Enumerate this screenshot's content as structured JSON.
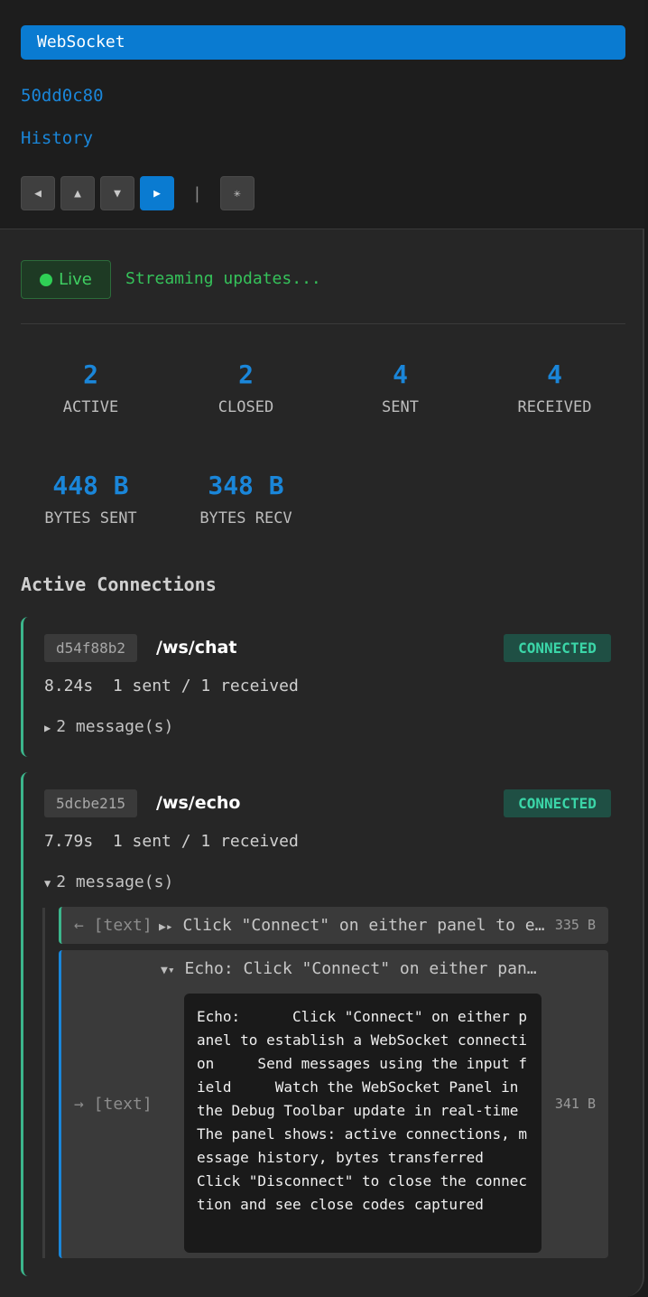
{
  "header": {
    "title": "WebSocket",
    "request_id": "50dd0c80",
    "history_link": "History",
    "nav_buttons": [
      "◀",
      "▲",
      "▼",
      "▶"
    ],
    "nav_separator": "|",
    "refresh_icon": "✳"
  },
  "live": {
    "badge_label": "Live",
    "status_text": "Streaming updates..."
  },
  "stats": [
    {
      "value": "2",
      "label": "ACTIVE"
    },
    {
      "value": "2",
      "label": "CLOSED"
    },
    {
      "value": "4",
      "label": "SENT"
    },
    {
      "value": "4",
      "label": "RECEIVED"
    },
    {
      "value": "448 B",
      "label": "BYTES SENT"
    },
    {
      "value": "348 B",
      "label": "BYTES RECV"
    }
  ],
  "section_title": "Active Connections",
  "connections": [
    {
      "id": "d54f88b2",
      "path": "/ws/chat",
      "status": "CONNECTED",
      "duration": "8.24s",
      "counts": "1 sent / 1 received",
      "toggle_icon": "▶",
      "messages_label": "2 message(s)"
    },
    {
      "id": "5dcbe215",
      "path": "/ws/echo",
      "status": "CONNECTED",
      "duration": "7.79s",
      "counts": "1 sent / 1 received",
      "toggle_icon": "▼",
      "messages_label": "2 message(s)"
    }
  ],
  "messages": [
    {
      "direction": "← [text]",
      "expander": "▶▸",
      "preview": "Click \"Connect\" on either panel to establish a WebSocket connection",
      "size": "335 B"
    },
    {
      "direction": "→ [text]",
      "expander": "▼▾",
      "preview": "Echo: Click \"Connect\" on either panel to establish a WebSocket connection",
      "size": "341 B",
      "body": "Echo:      Click \"Connect\" on either panel to establish a WebSocket connection     Send messages using the input field     Watch the WebSocket Panel in the Debug Toolbar update in real-time     The panel shows: active connections, message history, bytes transferred     Click \"Disconnect\" to close the connection and see close codes captured"
    }
  ],
  "colors": {
    "accent": "#0a7bd1",
    "live_green": "#3fcf62",
    "connected_teal": "#3bd6a8",
    "incoming_border": "#3cb68c",
    "outgoing_border": "#1a86d9"
  }
}
